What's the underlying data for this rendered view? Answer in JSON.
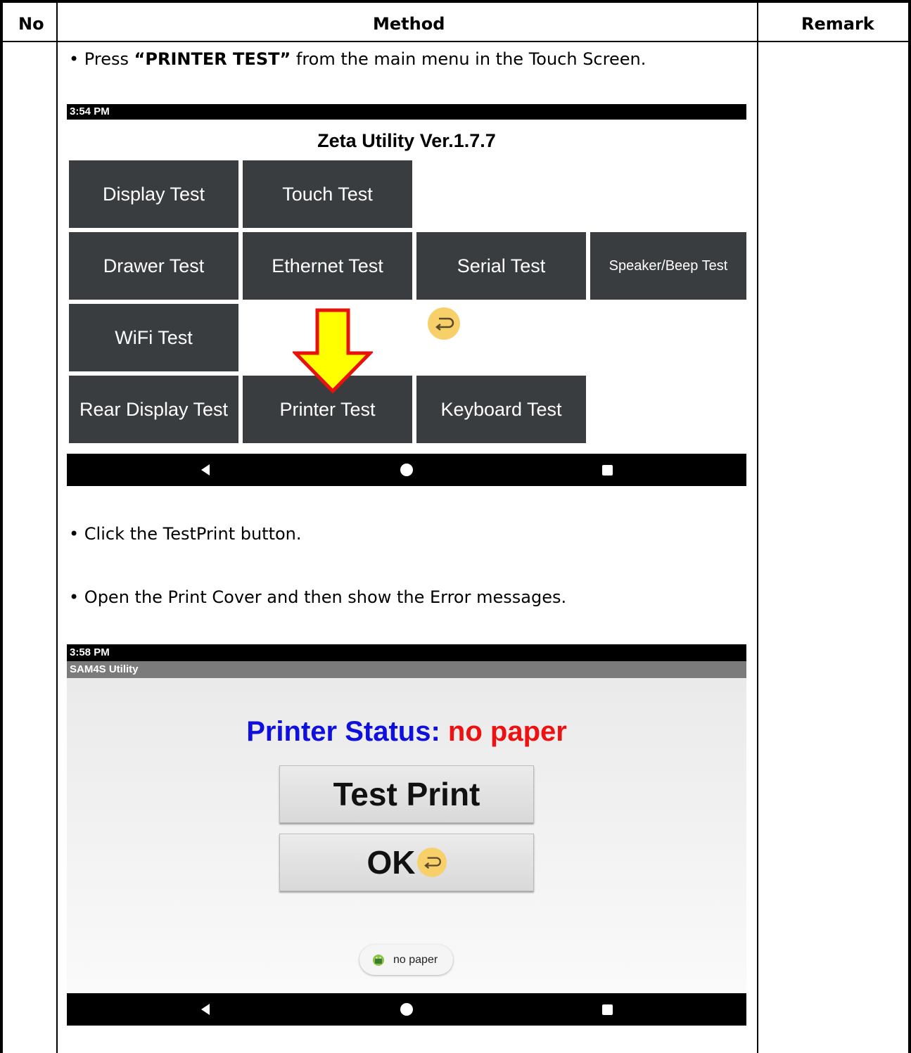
{
  "table": {
    "col_no": "No",
    "col_method": "Method",
    "col_remark": "Remark"
  },
  "steps": {
    "step1_prefix": "Press ",
    "step1_bold": "“PRINTER TEST”",
    "step1_suffix": " from the main menu in the Touch Screen.",
    "step2": "Click the TestPrint button.",
    "step3": "Open the Print Cover and then show the Error messages."
  },
  "screen1": {
    "time": "3:54 PM",
    "title": "Zeta Utility Ver.1.7.7",
    "tiles": {
      "display": "Display Test",
      "touch": "Touch Test",
      "drawer": "Drawer Test",
      "ethernet": "Ethernet Test",
      "serial": "Serial Test",
      "speaker": "Speaker/Beep Test",
      "wifi": "WiFi Test",
      "rear": "Rear Display Test",
      "printer": "Printer Test",
      "keyboard": "Keyboard Test"
    },
    "arrow_color": "#ffff00",
    "arrow_outline": "#e8120c"
  },
  "screen2": {
    "time": "3:58 PM",
    "app_title": "SAM4S Utility",
    "status_label": "Printer Status: ",
    "status_value": "no paper",
    "status_label_color": "#1010dd",
    "status_value_color": "#ee1111",
    "test_print": "Test Print",
    "ok": "OK",
    "toast": "no paper"
  },
  "icons": {
    "nav_back": "back-triangle-icon",
    "nav_home": "home-circle-icon",
    "nav_recent": "recent-square-icon",
    "undo": "undo-arrow-icon",
    "android": "android-icon"
  }
}
